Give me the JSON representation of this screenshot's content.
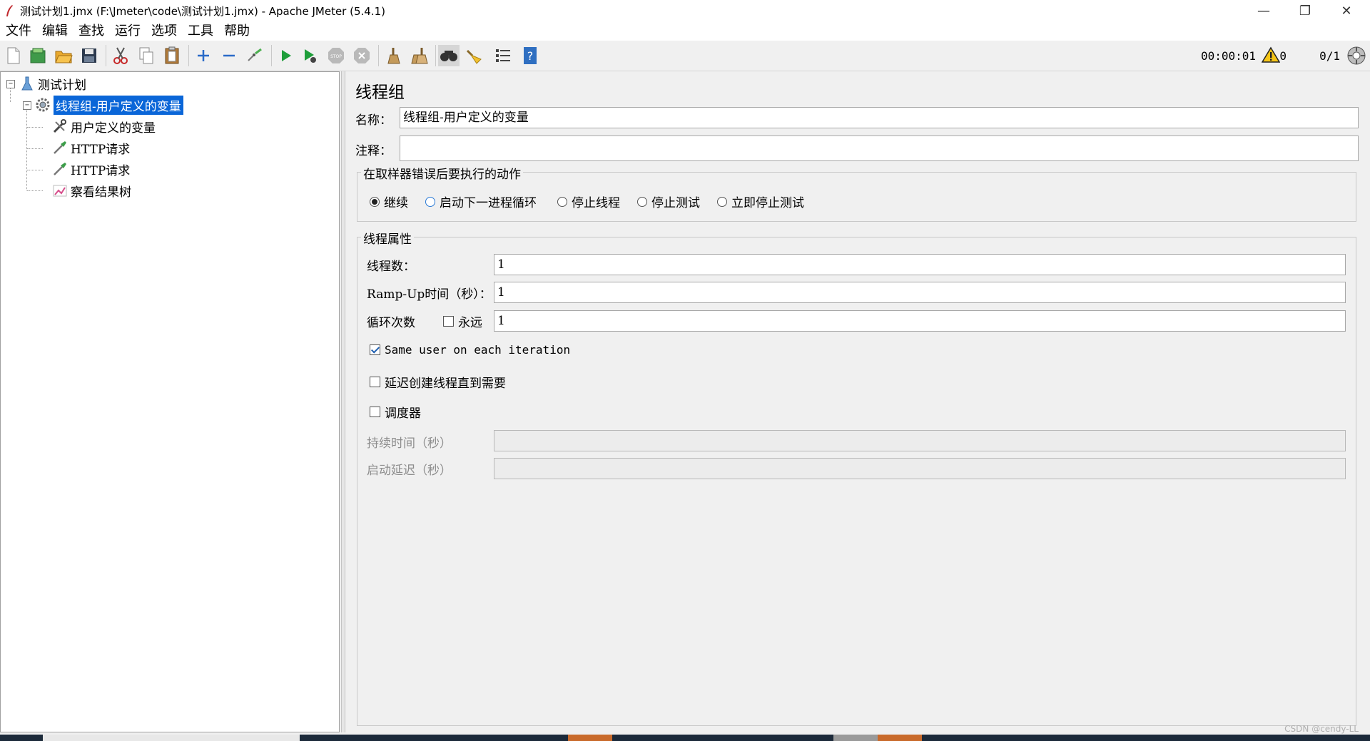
{
  "window": {
    "title": "测试计划1.jmx (F:\\Jmeter\\code\\测试计划1.jmx) - Apache JMeter (5.4.1)",
    "minimize_glyph": "—",
    "maximize_glyph": "❐",
    "close_glyph": "✕"
  },
  "menu": [
    "文件",
    "编辑",
    "查找",
    "运行",
    "选项",
    "工具",
    "帮助"
  ],
  "toolbar": {
    "icons": [
      "new-icon",
      "templates-icon",
      "open-icon",
      "save-icon",
      "cut-icon",
      "copy-icon",
      "paste-icon",
      "expand-icon",
      "collapse-icon",
      "toggle-icon",
      "start-icon",
      "start-no-pause-icon",
      "stop-icon",
      "shutdown-icon",
      "clear-icon",
      "clear-all-icon",
      "search-icon",
      "reset-search-icon",
      "function-helper-icon",
      "help-icon"
    ],
    "elapsed_time": "00:00:01",
    "error_count": "0",
    "thread_count": "0/1"
  },
  "tree": {
    "root": "测试计划",
    "thread_group": "线程组-用户定义的变量",
    "children": [
      "用户定义的变量",
      "HTTP请求",
      "HTTP请求",
      "察看结果树"
    ]
  },
  "editor": {
    "title": "线程组",
    "name_label": "名称：",
    "name_value": "线程组-用户定义的变量",
    "comment_label": "注释：",
    "comment_value": "",
    "error_action_group": "在取样器错误后要执行的动作",
    "error_actions": [
      "继续",
      "启动下一进程循环",
      "停止线程",
      "停止测试",
      "立即停止测试"
    ],
    "error_action_selected": "继续",
    "thread_props_group": "线程属性",
    "threads_label": "线程数：",
    "threads_value": "1",
    "rampup_label": "Ramp-Up时间（秒）：",
    "rampup_value": "1",
    "loop_label": "循环次数",
    "forever_label": "永远",
    "forever_checked": false,
    "loop_value": "1",
    "same_user_label": "Same user on each iteration",
    "same_user_checked": true,
    "delay_label": "延迟创建线程直到需要",
    "delay_checked": false,
    "scheduler_label": "调度器",
    "scheduler_checked": false,
    "duration_label": "持续时间（秒）",
    "duration_value": "",
    "startup_delay_label": "启动延迟（秒）",
    "startup_delay_value": ""
  },
  "watermark": "CSDN @cendy-LL"
}
